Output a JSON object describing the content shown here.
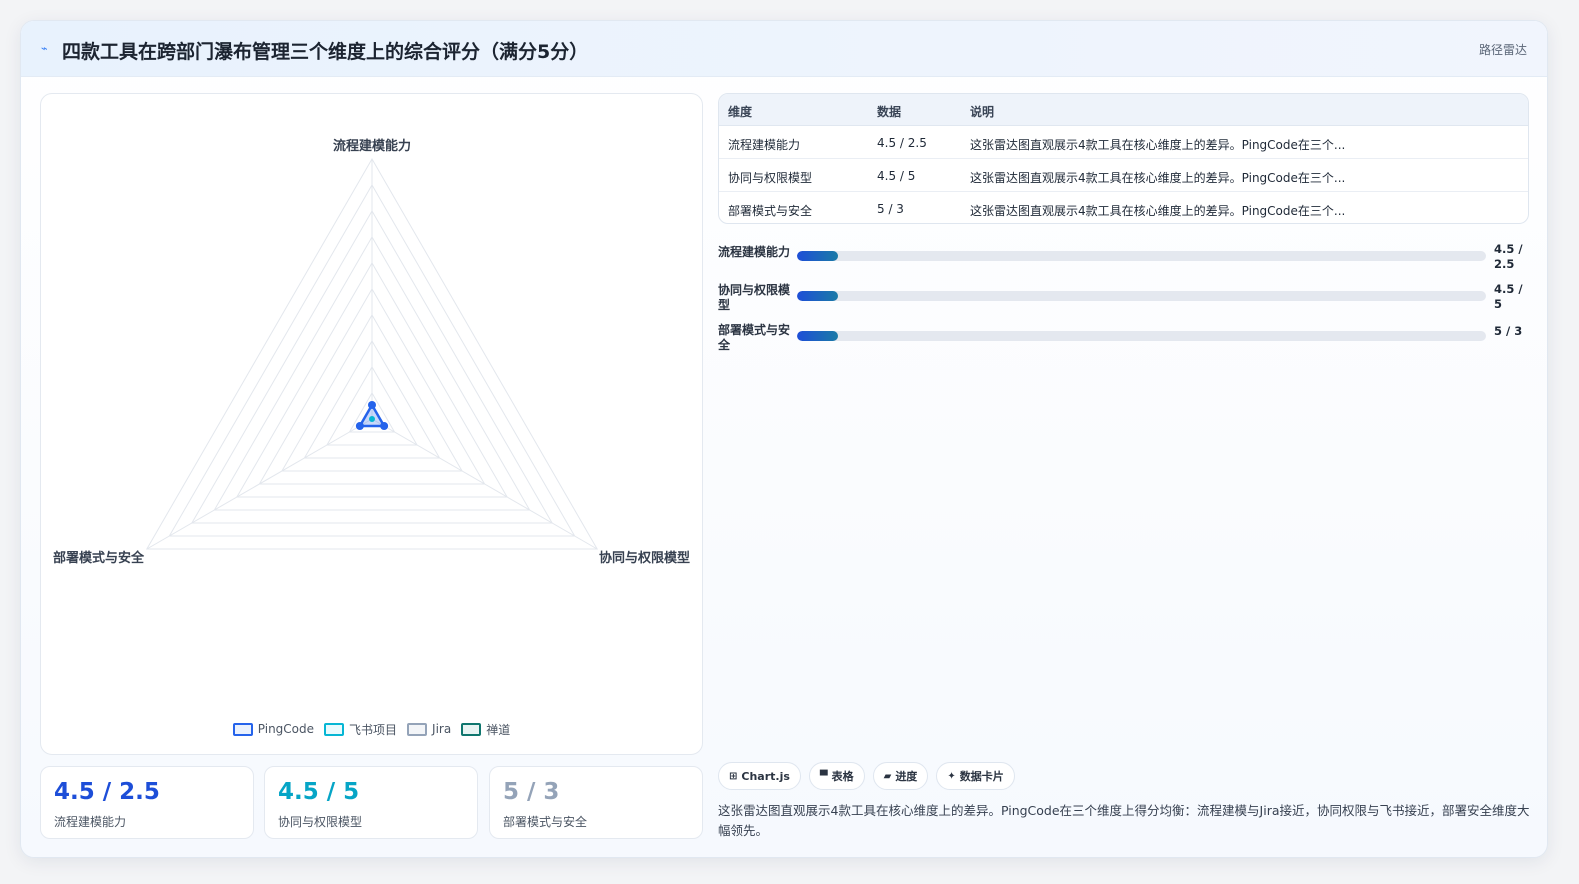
{
  "header": {
    "icon": "line-chart-icon",
    "title": "四款工具在跨部门瀑布管理三个维度上的综合评分（满分5分）",
    "link": "路径雷达"
  },
  "chart_data": {
    "type": "radar",
    "axes": [
      "流程建模能力",
      "协同与权限模型",
      "部署模式与安全"
    ],
    "legend": [
      "PingCode",
      "飞书项目",
      "Jira",
      "禅道"
    ],
    "legend_colors": [
      "#2563eb",
      "#06b6d4",
      "#94a3b8",
      "#0f766e"
    ],
    "grid": true,
    "legend_position": "bottom"
  },
  "stats": [
    {
      "value": "4.5 / 2.5",
      "label": "流程建模能力",
      "color": "#1d4ed8"
    },
    {
      "value": "4.5 / 5",
      "label": "协同与权限模型",
      "color": "#06a5c6"
    },
    {
      "value": "5 / 3",
      "label": "部署模式与安全",
      "color": "#94a3b8"
    }
  ],
  "table": {
    "headers": [
      "维度",
      "数据",
      "说明"
    ],
    "rows": [
      [
        "流程建模能力",
        "4.5 / 2.5",
        "这张雷达图直观展示4款工具在核心维度上的差异。PingCode在三个..."
      ],
      [
        "协同与权限模型",
        "4.5 / 5",
        "这张雷达图直观展示4款工具在核心维度上的差异。PingCode在三个..."
      ],
      [
        "部署模式与安全",
        "5 / 3",
        "这张雷达图直观展示4款工具在核心维度上的差异。PingCode在三个..."
      ]
    ]
  },
  "progress": [
    {
      "label": "流程建模能力",
      "value": "4.5 / 2.5",
      "fraction": 0.06
    },
    {
      "label": "协同与权限模型",
      "value": "4.5 / 5",
      "fraction": 0.06
    },
    {
      "label": "部署模式与安全",
      "value": "5 / 3",
      "fraction": 0.06
    }
  ],
  "tags": [
    {
      "icon": "grid-icon",
      "glyph": "⊞",
      "label": "Chart.js"
    },
    {
      "icon": "table-icon",
      "glyph": "▀",
      "label": "表格"
    },
    {
      "icon": "progress-icon",
      "glyph": "▰",
      "label": "进度"
    },
    {
      "icon": "sparkle-icon",
      "glyph": "✦",
      "label": "数据卡片"
    }
  ],
  "footnote": "这张雷达图直观展示4款工具在核心维度上的差异。PingCode在三个维度上得分均衡：流程建模与Jira接近，协同权限与飞书接近，部署安全维度大幅领先。"
}
